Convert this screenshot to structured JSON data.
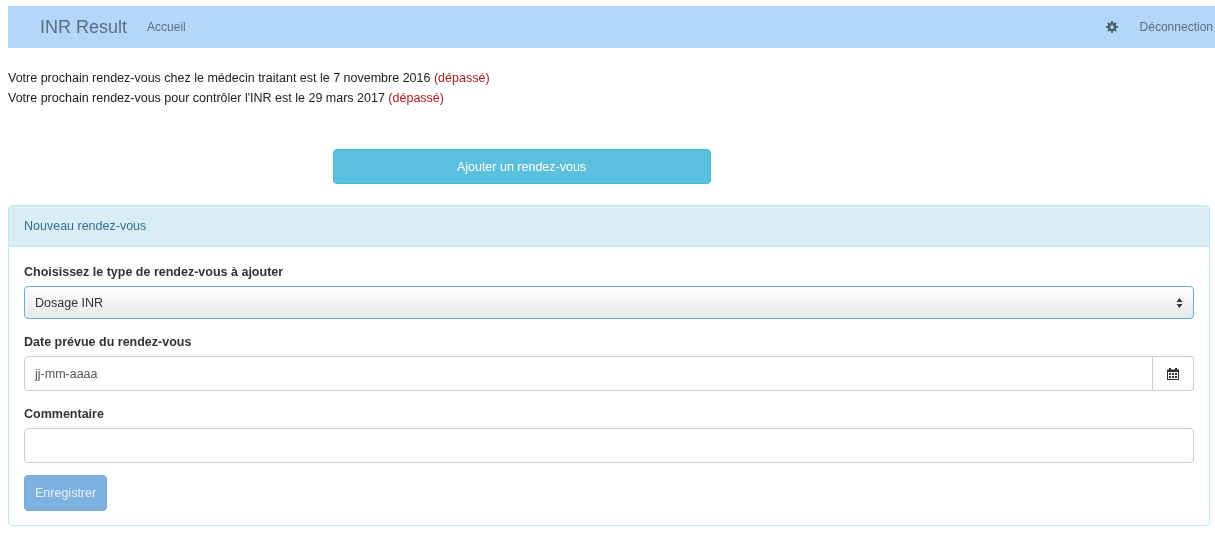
{
  "navbar": {
    "brand": "INR Result",
    "links": [
      {
        "label": "Accueil"
      }
    ],
    "logout": "Déconnection"
  },
  "notices": [
    {
      "text": "Votre prochain rendez-vous chez le médecin traitant est le 7 novembre 2016",
      "status": "(dépassé)",
      "overdue": true
    },
    {
      "text": "Votre prochain rendez-vous pour contrôler l'INR est le 29 mars 2017",
      "status": "(dépassé)",
      "overdue": true
    }
  ],
  "add_button": "Ajouter un rendez-vous",
  "panel": {
    "title": "Nouveau rendez-vous",
    "fields": [
      {
        "kind": "select",
        "label": "Choisissez le type de rendez-vous à ajouter",
        "value": "Dosage INR",
        "focused": true
      },
      {
        "kind": "date",
        "label": "Date prévue du rendez-vous",
        "placeholder": "jj-mm-aaaa",
        "focused": false
      },
      {
        "kind": "text",
        "label": "Commentaire",
        "focused": false
      }
    ],
    "submit": {
      "label": "Enregistrer",
      "disabled": true
    }
  }
}
